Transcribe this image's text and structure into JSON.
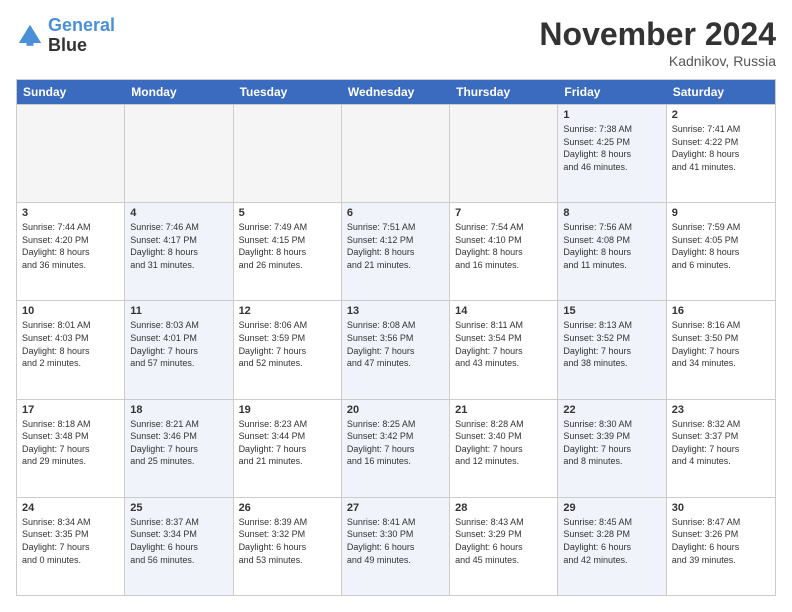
{
  "header": {
    "logo_line1": "General",
    "logo_line2": "Blue",
    "month": "November 2024",
    "location": "Kadnikov, Russia"
  },
  "weekdays": [
    "Sunday",
    "Monday",
    "Tuesday",
    "Wednesday",
    "Thursday",
    "Friday",
    "Saturday"
  ],
  "rows": [
    [
      {
        "day": "",
        "info": "",
        "empty": true
      },
      {
        "day": "",
        "info": "",
        "empty": true
      },
      {
        "day": "",
        "info": "",
        "empty": true
      },
      {
        "day": "",
        "info": "",
        "empty": true
      },
      {
        "day": "",
        "info": "",
        "empty": true
      },
      {
        "day": "1",
        "info": "Sunrise: 7:38 AM\nSunset: 4:25 PM\nDaylight: 8 hours\nand 46 minutes.",
        "shaded": true
      },
      {
        "day": "2",
        "info": "Sunrise: 7:41 AM\nSunset: 4:22 PM\nDaylight: 8 hours\nand 41 minutes.",
        "shaded": false
      }
    ],
    [
      {
        "day": "3",
        "info": "Sunrise: 7:44 AM\nSunset: 4:20 PM\nDaylight: 8 hours\nand 36 minutes.",
        "shaded": false
      },
      {
        "day": "4",
        "info": "Sunrise: 7:46 AM\nSunset: 4:17 PM\nDaylight: 8 hours\nand 31 minutes.",
        "shaded": true
      },
      {
        "day": "5",
        "info": "Sunrise: 7:49 AM\nSunset: 4:15 PM\nDaylight: 8 hours\nand 26 minutes.",
        "shaded": false
      },
      {
        "day": "6",
        "info": "Sunrise: 7:51 AM\nSunset: 4:12 PM\nDaylight: 8 hours\nand 21 minutes.",
        "shaded": true
      },
      {
        "day": "7",
        "info": "Sunrise: 7:54 AM\nSunset: 4:10 PM\nDaylight: 8 hours\nand 16 minutes.",
        "shaded": false
      },
      {
        "day": "8",
        "info": "Sunrise: 7:56 AM\nSunset: 4:08 PM\nDaylight: 8 hours\nand 11 minutes.",
        "shaded": true
      },
      {
        "day": "9",
        "info": "Sunrise: 7:59 AM\nSunset: 4:05 PM\nDaylight: 8 hours\nand 6 minutes.",
        "shaded": false
      }
    ],
    [
      {
        "day": "10",
        "info": "Sunrise: 8:01 AM\nSunset: 4:03 PM\nDaylight: 8 hours\nand 2 minutes.",
        "shaded": false
      },
      {
        "day": "11",
        "info": "Sunrise: 8:03 AM\nSunset: 4:01 PM\nDaylight: 7 hours\nand 57 minutes.",
        "shaded": true
      },
      {
        "day": "12",
        "info": "Sunrise: 8:06 AM\nSunset: 3:59 PM\nDaylight: 7 hours\nand 52 minutes.",
        "shaded": false
      },
      {
        "day": "13",
        "info": "Sunrise: 8:08 AM\nSunset: 3:56 PM\nDaylight: 7 hours\nand 47 minutes.",
        "shaded": true
      },
      {
        "day": "14",
        "info": "Sunrise: 8:11 AM\nSunset: 3:54 PM\nDaylight: 7 hours\nand 43 minutes.",
        "shaded": false
      },
      {
        "day": "15",
        "info": "Sunrise: 8:13 AM\nSunset: 3:52 PM\nDaylight: 7 hours\nand 38 minutes.",
        "shaded": true
      },
      {
        "day": "16",
        "info": "Sunrise: 8:16 AM\nSunset: 3:50 PM\nDaylight: 7 hours\nand 34 minutes.",
        "shaded": false
      }
    ],
    [
      {
        "day": "17",
        "info": "Sunrise: 8:18 AM\nSunset: 3:48 PM\nDaylight: 7 hours\nand 29 minutes.",
        "shaded": false
      },
      {
        "day": "18",
        "info": "Sunrise: 8:21 AM\nSunset: 3:46 PM\nDaylight: 7 hours\nand 25 minutes.",
        "shaded": true
      },
      {
        "day": "19",
        "info": "Sunrise: 8:23 AM\nSunset: 3:44 PM\nDaylight: 7 hours\nand 21 minutes.",
        "shaded": false
      },
      {
        "day": "20",
        "info": "Sunrise: 8:25 AM\nSunset: 3:42 PM\nDaylight: 7 hours\nand 16 minutes.",
        "shaded": true
      },
      {
        "day": "21",
        "info": "Sunrise: 8:28 AM\nSunset: 3:40 PM\nDaylight: 7 hours\nand 12 minutes.",
        "shaded": false
      },
      {
        "day": "22",
        "info": "Sunrise: 8:30 AM\nSunset: 3:39 PM\nDaylight: 7 hours\nand 8 minutes.",
        "shaded": true
      },
      {
        "day": "23",
        "info": "Sunrise: 8:32 AM\nSunset: 3:37 PM\nDaylight: 7 hours\nand 4 minutes.",
        "shaded": false
      }
    ],
    [
      {
        "day": "24",
        "info": "Sunrise: 8:34 AM\nSunset: 3:35 PM\nDaylight: 7 hours\nand 0 minutes.",
        "shaded": false
      },
      {
        "day": "25",
        "info": "Sunrise: 8:37 AM\nSunset: 3:34 PM\nDaylight: 6 hours\nand 56 minutes.",
        "shaded": true
      },
      {
        "day": "26",
        "info": "Sunrise: 8:39 AM\nSunset: 3:32 PM\nDaylight: 6 hours\nand 53 minutes.",
        "shaded": false
      },
      {
        "day": "27",
        "info": "Sunrise: 8:41 AM\nSunset: 3:30 PM\nDaylight: 6 hours\nand 49 minutes.",
        "shaded": true
      },
      {
        "day": "28",
        "info": "Sunrise: 8:43 AM\nSunset: 3:29 PM\nDaylight: 6 hours\nand 45 minutes.",
        "shaded": false
      },
      {
        "day": "29",
        "info": "Sunrise: 8:45 AM\nSunset: 3:28 PM\nDaylight: 6 hours\nand 42 minutes.",
        "shaded": true
      },
      {
        "day": "30",
        "info": "Sunrise: 8:47 AM\nSunset: 3:26 PM\nDaylight: 6 hours\nand 39 minutes.",
        "shaded": false
      }
    ]
  ]
}
